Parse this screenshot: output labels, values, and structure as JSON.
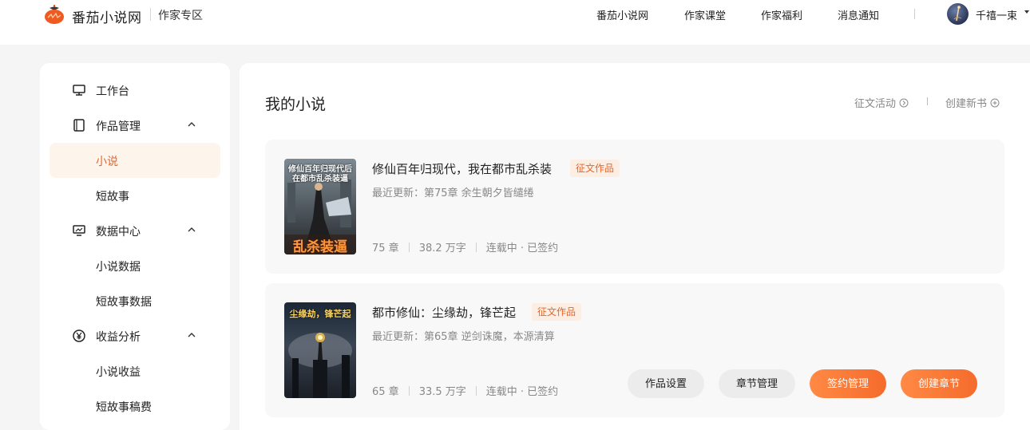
{
  "header": {
    "brand": "番茄小说网",
    "subtitle": "作家专区",
    "nav": [
      "番茄小说网",
      "作家课堂",
      "作家福利",
      "消息通知"
    ],
    "username": "千禧一束"
  },
  "sidebar": {
    "items": [
      {
        "label": "工作台",
        "icon": "monitor-icon"
      },
      {
        "label": "作品管理",
        "icon": "book-icon",
        "expanded": true
      },
      {
        "label": "小说",
        "sub": true,
        "active": true
      },
      {
        "label": "短故事",
        "sub": true
      },
      {
        "label": "数据中心",
        "icon": "chart-monitor-icon",
        "expanded": true
      },
      {
        "label": "小说数据",
        "sub": true
      },
      {
        "label": "短故事数据",
        "sub": true
      },
      {
        "label": "收益分析",
        "icon": "yen-icon",
        "expanded": true
      },
      {
        "label": "小说收益",
        "sub": true
      },
      {
        "label": "短故事稿费",
        "sub": true
      }
    ]
  },
  "main": {
    "title": "我的小说",
    "actions": [
      "征文活动",
      "创建新书"
    ],
    "books": [
      {
        "title": "修仙百年归现代，我在都市乱杀装",
        "tag": "征文作品",
        "latest": "最近更新：第75章 余生朝夕皆缱绻",
        "chapters": "75 章",
        "words": "38.2 万字",
        "status": "连载中 · 已签约",
        "cover_top": "修仙百年归现代后\n在都市乱杀装逼",
        "cover_bottom": "乱杀装逼"
      },
      {
        "title": "都市修仙：尘缘劫，锋芒起",
        "tag": "征文作品",
        "latest": "最近更新：第65章 逆剑诛魔，本源清算",
        "chapters": "65 章",
        "words": "33.5 万字",
        "status": "连载中 · 已签约",
        "cover_top": "尘缘劫，锋芒起"
      }
    ],
    "buttons": [
      "作品设置",
      "章节管理",
      "签约管理",
      "创建章节"
    ]
  },
  "colors": {
    "accent": "#e8662a",
    "active_bg": "#fdf4ec",
    "tag_bg": "#fdeee3"
  }
}
